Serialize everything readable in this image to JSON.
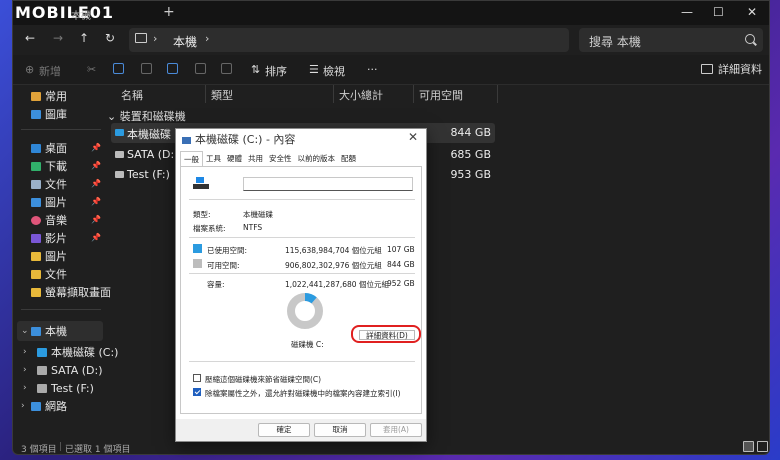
{
  "watermark": "MOBILE01",
  "window": {
    "tab_title": "本機",
    "new_tab": "+",
    "minimize": "—",
    "maximize": "☐",
    "close": "✕"
  },
  "nav": {
    "back": "←",
    "forward": "→",
    "up": "↑",
    "refresh": "↻",
    "path": "本機",
    "sep": "›"
  },
  "search": {
    "placeholder": "搜尋 本機"
  },
  "toolbar": {
    "new_label": "新增",
    "sort_label": "排序",
    "view_label": "檢視",
    "more_label": "···",
    "details_label": "詳細資料"
  },
  "sidebar": {
    "quick_access": "常用",
    "gallery": "圖庫",
    "pinned": [
      {
        "label": "桌面",
        "color": "#2f86d6"
      },
      {
        "label": "下載",
        "color": "#31b06b"
      },
      {
        "label": "文件",
        "color": "#9ab0c8"
      },
      {
        "label": "圖片",
        "color": "#3c8fdc"
      },
      {
        "label": "音樂",
        "color": "#e0557a"
      },
      {
        "label": "影片",
        "color": "#7a57d6"
      }
    ],
    "folders": [
      {
        "label": "圖片",
        "color": "#e8b93a"
      },
      {
        "label": "文件",
        "color": "#e8b93a"
      },
      {
        "label": "螢幕擷取畫面",
        "color": "#e8b93a"
      }
    ],
    "this_pc": "本機",
    "drives": [
      "本機磁碟 (C:)",
      "SATA (D:)",
      "Test (F:)"
    ],
    "network": "網路"
  },
  "columns": {
    "name": "名稱",
    "type": "類型",
    "total": "大小總計",
    "free": "可用空間"
  },
  "group_header": "裝置和磁碟機",
  "rows": [
    {
      "name": "本機磁碟 (C:)",
      "free": "844 GB"
    },
    {
      "name": "SATA (D:)",
      "free": "685 GB"
    },
    {
      "name": "Test (F:)",
      "free": "953 GB"
    }
  ],
  "status": {
    "count": "3 個項目",
    "selected": "已選取 1 個項目"
  },
  "dialog": {
    "title": "本機磁碟 (C:) - 內容",
    "close": "✕",
    "tabs": [
      "一般",
      "工具",
      "硬體",
      "共用",
      "安全性",
      "以前的版本",
      "配額"
    ],
    "type_label": "類型:",
    "type_value": "本機磁碟",
    "fs_label": "檔案系統:",
    "fs_value": "NTFS",
    "used_label": "已使用空間:",
    "used_bytes": "115,638,984,704 個位元組",
    "used_gb": "107 GB",
    "free_label": "可用空間:",
    "free_bytes": "906,802,302,976 個位元組",
    "free_gb": "844 GB",
    "capacity_label": "容量:",
    "capacity_bytes": "1,022,441,287,680 個位元組",
    "capacity_gb": "952 GB",
    "drive_label": "磁碟機 C:",
    "details_button": "詳細資料(D)",
    "compress_label": "壓縮這個磁碟機來節省磁碟空間(C)",
    "index_label": "除檔案屬性之外，還允許對磁碟機中的檔案內容建立索引(I)",
    "ok": "確定",
    "cancel": "取消",
    "apply": "套用(A)",
    "used_color": "#2b9be0",
    "free_color": "#c8c8c8",
    "used_fraction": 0.113
  }
}
